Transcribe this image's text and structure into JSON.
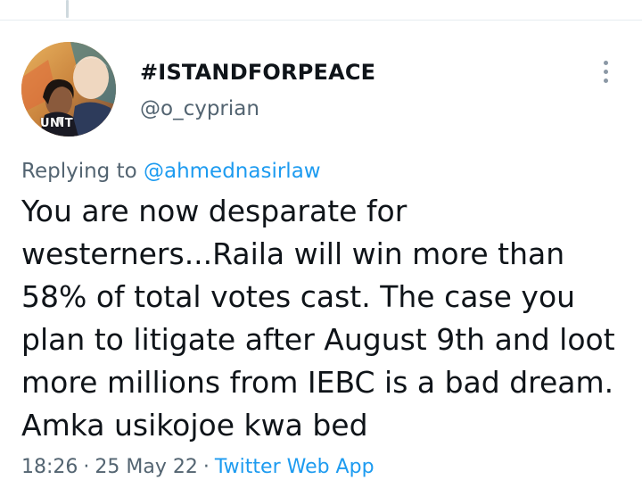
{
  "tweet": {
    "display_name": "#ISTANDFORPEACE",
    "handle": "@o_cyprian",
    "avatar_caption": "UNIT",
    "replying_prefix": "Replying to",
    "replying_handle": "@ahmednasirlaw",
    "text_lines": [
      "You are now desparate for",
      "westerners...Raila will win more than",
      "58% of total votes cast. The case you",
      "plan to litigate after August 9th and loot",
      "more millions from IEBC is a bad dream.",
      "Amka usikojoe kwa bed"
    ],
    "time": "18:26",
    "separator": "·",
    "date": "25 May 22",
    "source": "Twitter Web App"
  },
  "icons": {
    "more": "more-vertical-icon"
  },
  "colors": {
    "link": "#1d9bf0",
    "secondary_text": "#536471",
    "primary_text": "#0f1419",
    "divider": "#e6ecf0"
  }
}
